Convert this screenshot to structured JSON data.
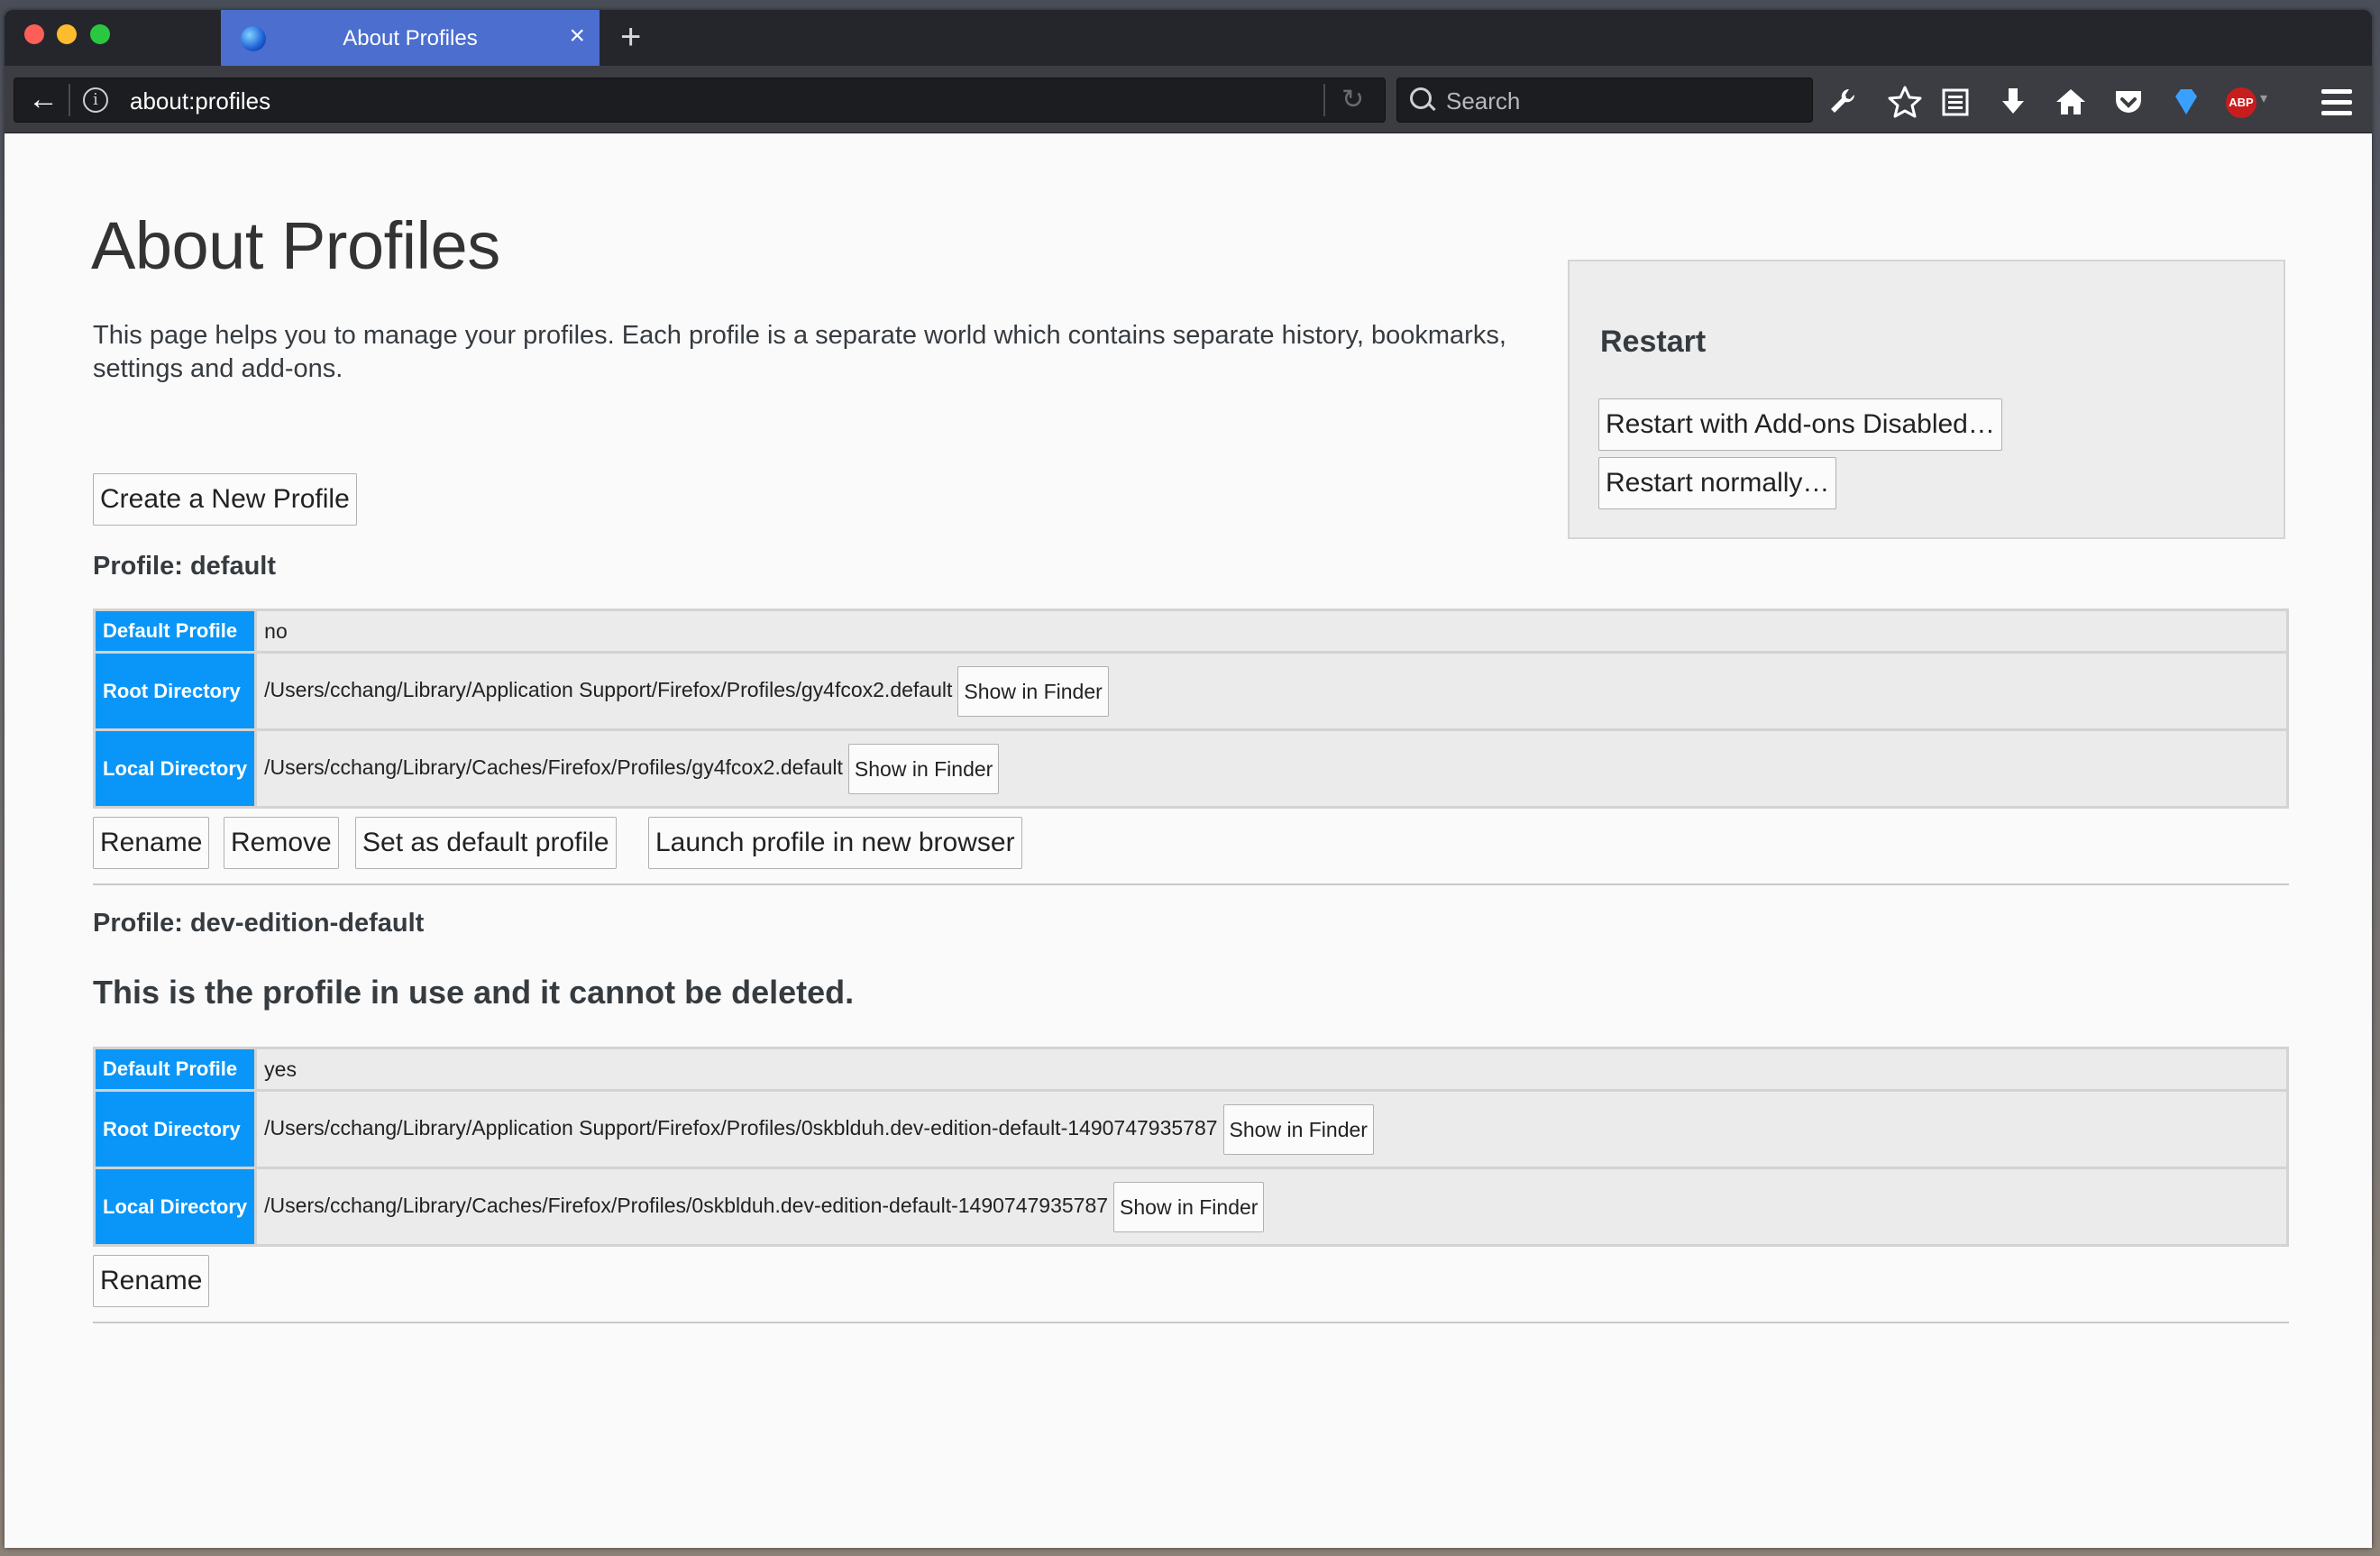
{
  "browser": {
    "tab": {
      "title": "About Profiles",
      "close": "×",
      "new_tab": "+"
    },
    "url": "about:profiles",
    "search_placeholder": "Search",
    "toolbar_icons": [
      "wrench-icon",
      "star-icon",
      "reading-list-icon",
      "download-icon",
      "home-icon",
      "pocket-icon",
      "gem-icon",
      "adblock-icon",
      "menu-icon"
    ],
    "adblock_label": "ABP"
  },
  "page": {
    "title": "About Profiles",
    "intro": "This page helps you to manage your profiles. Each profile is a separate world which contains separate history, bookmarks, settings and add-ons.",
    "create_button": "Create a New Profile",
    "restart": {
      "heading": "Restart",
      "disabled_button": "Restart with Add-ons Disabled…",
      "normal_button": "Restart normally…"
    },
    "labels": {
      "default_profile": "Default Profile",
      "root_directory": "Root Directory",
      "local_directory": "Local Directory",
      "show_in_finder": "Show in Finder"
    },
    "profiles": [
      {
        "heading": "Profile: default",
        "is_default": "no",
        "root_dir": "/Users/cchang/Library/Application Support/Firefox/Profiles/gy4fcox2.default",
        "local_dir": "/Users/cchang/Library/Caches/Firefox/Profiles/gy4fcox2.default",
        "actions": [
          "Rename",
          "Remove",
          "Set as default profile",
          "Launch profile in new browser"
        ]
      },
      {
        "heading": "Profile: dev-edition-default",
        "in_use_note": "This is the profile in use and it cannot be deleted.",
        "is_default": "yes",
        "root_dir": "/Users/cchang/Library/Application Support/Firefox/Profiles/0skblduh.dev-edition-default-1490747935787",
        "local_dir": "/Users/cchang/Library/Caches/Firefox/Profiles/0skblduh.dev-edition-default-1490747935787",
        "actions": [
          "Rename"
        ]
      }
    ]
  },
  "colors": {
    "tab_active": "#4b6ecf",
    "table_header": "#0996f8",
    "chrome_dark": "#24262c"
  }
}
